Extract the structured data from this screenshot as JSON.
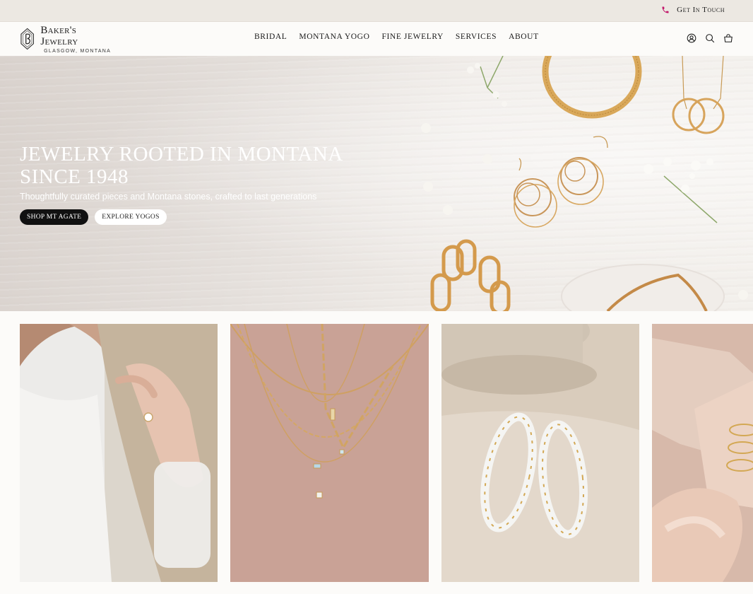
{
  "topbar": {
    "contact_label": "Get In Touch"
  },
  "logo": {
    "name": "Baker's Jewelry",
    "location": "GLASGOW, MONTANA"
  },
  "nav": [
    "BRIDAL",
    "MONTANA YOGO",
    "FINE JEWELRY",
    "SERVICES",
    "ABOUT"
  ],
  "header_icons": [
    "account-icon",
    "search-icon",
    "cart-icon"
  ],
  "hero": {
    "title": "JEWELRY ROOTED IN MONTANA SINCE 1948",
    "subtitle": "Thoughtfully curated pieces and Montana stones, crafted to last generations",
    "primary_button": "SHOP MT AGATE",
    "secondary_button": "EXPLORE YOGOS"
  },
  "colors": {
    "accent": "#c2186b",
    "dark": "#111111",
    "gold": "#d4a55a"
  }
}
